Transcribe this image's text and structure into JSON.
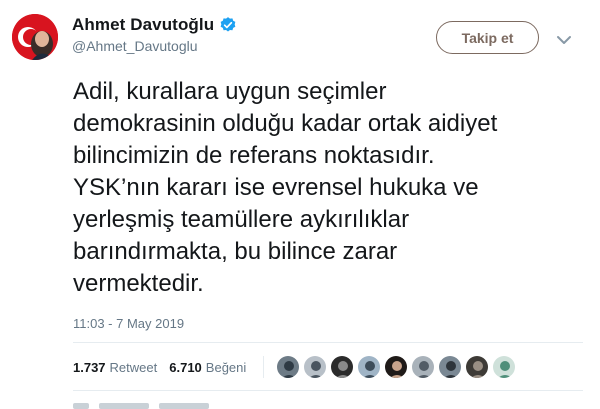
{
  "user": {
    "display_name": "Ahmet Davutoğlu",
    "handle": "@Ahmet_Davutoglu",
    "verified": true
  },
  "follow_button": {
    "label": "Takip et"
  },
  "menu": {
    "icon": "chevron-down-icon"
  },
  "tweet": {
    "lines": [
      "Adil, kurallara uygun seçimler",
      "demokrasinin olduğu kadar ortak aidiyet",
      "bilincimizin de referans noktasıdır.",
      "YSK’nın kararı ise evrensel hukuka ve",
      "yerleşmiş teamüllere aykırılıklar",
      "barındırmakta, bu bilince zarar",
      "vermektedir."
    ],
    "timestamp": "11:03 - 7 May 2019"
  },
  "stats": {
    "retweets_count": "1.737",
    "retweets_label": "Retweet",
    "likes_count": "6.710",
    "likes_label": "Beğeni"
  },
  "likers_count": 9,
  "colors": {
    "verified_blue": "#1da1f2",
    "follow_border": "#7c6a60",
    "muted_text": "#657786",
    "avatar_flag_red": "#d8141f"
  }
}
